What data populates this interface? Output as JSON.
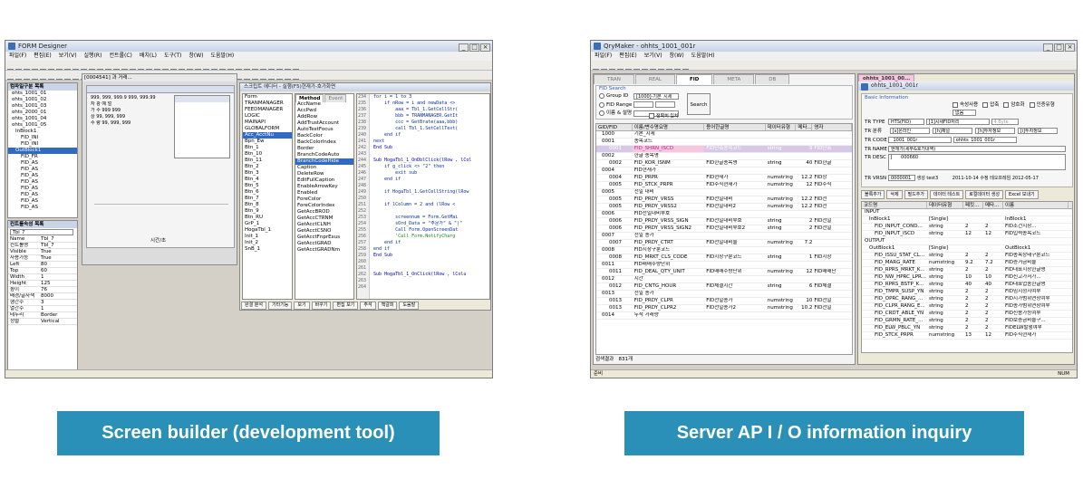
{
  "left": {
    "window_title": "FORM Designer",
    "menu": [
      "파일(F)",
      "편집(E)",
      "보기(V)",
      "실행(R)",
      "컨트롤(C)",
      "배치(L)",
      "도구(T)",
      "창(W)",
      "도움말(H)"
    ],
    "tree_panel_title": "컴파일구분 목록",
    "tree_items": [
      "ohts_1001_01",
      "ohts_1001_02",
      "ohts_1001_03",
      "ohts_2000_01",
      "ohts_1001_04",
      "ohts_1001_05",
      "InBlock1",
      "FID_INI",
      "FID_INI",
      "OutBlock1",
      "FID_FR",
      "FID_AS",
      "FID_AS",
      "FID_AS",
      "FID_AS",
      "FID_AS",
      "FID_AS",
      "FID_AS",
      "FID_AS"
    ],
    "props_panel_title": "컨트롤속성 목록",
    "props_combo": "Tbl_7",
    "props": [
      {
        "k": "Name",
        "v": "Tbl_7"
      },
      {
        "k": "컨트롤명",
        "v": "Tbl_7"
      },
      {
        "k": "Visible",
        "v": "True"
      },
      {
        "k": "사용가능",
        "v": "True"
      },
      {
        "k": "Left",
        "v": "80"
      },
      {
        "k": "Top",
        "v": "60"
      },
      {
        "k": "Width",
        "v": "1"
      },
      {
        "k": "Height",
        "v": "125"
      },
      {
        "k": "높이",
        "v": "76"
      },
      {
        "k": "배경/글자색",
        "v": "8000"
      },
      {
        "k": "행간수",
        "v": "3"
      },
      {
        "k": "열간수",
        "v": "1"
      },
      {
        "k": "테두리",
        "v": "Border"
      },
      {
        "k": "정렬",
        "v": "Vertical"
      }
    ],
    "status_time": "시간/초",
    "form_tab": "[0004541] 과 거래...",
    "grid_rows": [
      "999, 999, 999.9  999, 999.99",
      "자 광 예 얼",
      "가 수 999 999",
      "상   99, 999, 999",
      "수 량 99, 999, 999"
    ],
    "control_list_title": "스크립트 에디터",
    "controls": [
      "Form",
      "TRANMANAGER",
      "FEEDMANAGER",
      "LOGIC",
      "MAINAPI",
      "GLOBALFORM",
      "Acc_AcctNu",
      "Bpn_Ew",
      "Btn_1",
      "Btn_10",
      "Btn_11",
      "Btn_2",
      "Btn_3",
      "Btn_4",
      "Btn_5",
      "Btn_6",
      "Btn_7",
      "Btn_8",
      "Btn_9",
      "Btn_RU",
      "GrP_1",
      "HogaTbl_1",
      "Init_1",
      "Init_2",
      "SnB_1"
    ],
    "method_tab": "Method",
    "event_tab": "Event",
    "methods": [
      "AccName",
      "AccPwd",
      "AddRow",
      "AddTrustAccount",
      "AutoTextFocus",
      "BackColor",
      "BackColorIndex",
      "Border",
      "BranchCodeAuto",
      "BranchCodeHide",
      "Caption",
      "DeleteRow",
      "EditFullCaption",
      "EnableArrowKey",
      "Enabled",
      "ForeColor",
      "ForeColorIndex",
      "GetAccBROD",
      "GetAccCTRNM",
      "GetAcctCLNH",
      "GetAcctCSNO",
      "GetAcctFnprExus",
      "GetAcctGRAD",
      "GetAcctGRADNm"
    ],
    "script_title": "실행(F5)현재가-호가화면",
    "line_numbers": [
      "234",
      "235",
      "236",
      "237",
      "238",
      "239",
      "240",
      "241",
      "242",
      "243",
      "244",
      "245",
      "246",
      "247",
      "248",
      "249",
      "250",
      "251",
      "252",
      "253",
      "254",
      "255",
      "256",
      "257",
      "258",
      "259",
      "260",
      "261",
      "262",
      "263",
      "264"
    ],
    "code": [
      "for i = 1 to 3",
      "    if nRow = i and newData <> ",
      "        aaa = Tbl_1.GetCellStr(",
      "        bbb = TRANMANAGER.GetIt",
      "        ccc = GetBrate(aaa,bbb)",
      "        call Tbl_1.SetCellText(",
      "    end if",
      "next",
      "End Sub",
      "",
      "Sub HogaTbl_1_OnDblClick(lRow , lCol",
      "    if g_click <> \"2\" then",
      "        exit sub",
      "    end if",
      "",
      "    if HogaTbl_1.GetCellString(lRow",
      "",
      "    if lColumn = 2 and (lRow <",
      "",
      "        screennum = Form.GetMai",
      "        sOrd_Data = \"주문가\" & \"|\"",
      "        Call Form.OpenScreenDat",
      "        'Call Form.NotifyCharg",
      "    end if",
      "end if",
      "End Sub",
      "",
      "",
      "Sub HogaTbl_1_OnClick(lRow , lColu"
    ],
    "bottom_buttons": [
      "완결 분석",
      "기타기능",
      "보기",
      "바꾸기",
      "편집 보기",
      "주석",
      "책갈피",
      "도움말"
    ]
  },
  "right": {
    "window_title": "QryMaker - ohhts_1001_001r",
    "menu": [
      "파일(F)",
      "편집(E)",
      "보기(V)",
      "창(W)",
      "도움말(H)"
    ],
    "tabs": [
      "TRAN",
      "REAL",
      "FID",
      "META",
      "DB"
    ],
    "active_tab": "FID",
    "search_group": "FID Search",
    "group_id_label": "Group ID",
    "group_id_value": "[1000]-기본_시세",
    "fid_range_label": "FID Range",
    "name_label": "이름 & 설명",
    "search_button": "Search",
    "exact_label": "정확히 일치",
    "table_cols": [
      "GID/FID",
      "이름/변수명요명",
      "용어한글명",
      "데이터유형",
      "메타...",
      "영자"
    ],
    "table_rows": [
      {
        "id": "1000",
        "name": "기본_시세",
        "kor": "",
        "type": "",
        "len": "",
        "x": ""
      },
      {
        "id": "0001",
        "name": "종목코드",
        "kor": "",
        "type": "",
        "len": "",
        "x": ""
      },
      {
        "id": "0001",
        "name": "FID_SHRN_ISCD",
        "kor": "FID단축종목코드",
        "type": "string",
        "len": "9",
        "x": "FID단축"
      },
      {
        "id": "0002",
        "name": "한글 종목명",
        "kor": "",
        "type": "",
        "len": "",
        "x": ""
      },
      {
        "id": "0002",
        "name": "FID_KOR_ISNM",
        "kor": "FID한글종목명",
        "type": "string",
        "len": "40",
        "x": "FID한글"
      },
      {
        "id": "0004",
        "name": "FID현재가",
        "kor": "",
        "type": "",
        "len": "",
        "x": ""
      },
      {
        "id": "0004",
        "name": "FID_PRPR",
        "kor": "FID현재가",
        "type": "numstring",
        "len": "12.2",
        "x": "FID상"
      },
      {
        "id": "0005",
        "name": "FID_STCK_PRPR",
        "kor": "FID주식현재가",
        "type": "numstring",
        "len": "12",
        "x": "FID주식"
      },
      {
        "id": "0005",
        "name": "전일 대비",
        "kor": "",
        "type": "",
        "len": "",
        "x": ""
      },
      {
        "id": "0005",
        "name": "FID_PRDY_VRSS",
        "kor": "FID전일대비",
        "type": "numstring",
        "len": "12.2",
        "x": "FID전"
      },
      {
        "id": "0005",
        "name": "FID_PRDY_VRSS2",
        "kor": "FID전일대비2",
        "type": "numstring",
        "len": "12.2",
        "x": "FID전"
      },
      {
        "id": "0006",
        "name": "FID전일대비부호",
        "kor": "",
        "type": "",
        "len": "",
        "x": ""
      },
      {
        "id": "0006",
        "name": "FID_PRDY_VRSS_SIGN",
        "kor": "FID전일대비부호",
        "type": "string",
        "len": "2",
        "x": "FID전일"
      },
      {
        "id": "0006",
        "name": "FID_PRDY_VRSS_SIGN2",
        "kor": "FID전일대비부호2",
        "type": "string",
        "len": "2",
        "x": "FID전일"
      },
      {
        "id": "0007",
        "name": "전일 종가",
        "kor": "",
        "type": "",
        "len": "",
        "x": ""
      },
      {
        "id": "0007",
        "name": "FID_PRDY_CTRT",
        "kor": "FID전일대비율",
        "type": "numstring",
        "len": "7.2",
        "x": ""
      },
      {
        "id": "0008",
        "name": "FID시장구분코드",
        "kor": "",
        "type": "",
        "len": "",
        "x": ""
      },
      {
        "id": "0008",
        "name": "FID_MRKT_CLS_CODE",
        "kor": "FID시장구분코드",
        "type": "string",
        "len": "1",
        "x": "FID시장"
      },
      {
        "id": "0011",
        "name": "FID매매수량단위",
        "kor": "",
        "type": "",
        "len": "",
        "x": ""
      },
      {
        "id": "0011",
        "name": "FID_DEAL_QTY_UNIT",
        "kor": "FID매매수량단위",
        "type": "numstring",
        "len": "12",
        "x": "FID매매단"
      },
      {
        "id": "0012",
        "name": "시간",
        "kor": "",
        "type": "",
        "len": "",
        "x": ""
      },
      {
        "id": "0012",
        "name": "FID_CNTG_HOUR",
        "kor": "FID체결시간",
        "type": "string",
        "len": "6",
        "x": "FID체결"
      },
      {
        "id": "0013",
        "name": "전일 종가",
        "kor": "",
        "type": "",
        "len": "",
        "x": ""
      },
      {
        "id": "0013",
        "name": "FID_PRDY_CLPR",
        "kor": "FID전일종가",
        "type": "numstring",
        "len": "10",
        "x": "FID전일"
      },
      {
        "id": "0013",
        "name": "FID_PRDY_CLPR2",
        "kor": "FID전일종가2",
        "type": "numstring",
        "len": "10.2",
        "x": "FID전일"
      },
      {
        "id": "0014",
        "name": "누적 거래량",
        "kor": "",
        "type": "",
        "len": "",
        "x": ""
      }
    ],
    "result_label": "검색결과",
    "result_count": "831개",
    "status_left": "준비",
    "status_right": "NUM",
    "inner_tab": "ohhts_1001_00...",
    "inner_title": "ohhts_1001_001r",
    "basic_info": "Basic Information",
    "checks": [
      "속성사용",
      "압축",
      "암호화",
      "인증유형"
    ],
    "auth_value": "없음",
    "tr_type_label": "TR TYPE",
    "tr_type_value": "HTS(FID)",
    "tr_type_value2": "[1]시세FID처리",
    "tr_type_value3": "4 Byte",
    "tr_class_label": "TR 분류",
    "tr_class_values": [
      "[s]온라인",
      "[h]채널",
      "[h]투자정보",
      "[i]투자정보"
    ],
    "tr_code_label": "TR CODE",
    "tr_code_value": "_1001_001r",
    "tr_code_value2": "ohhts_1001_001r",
    "tr_name_label": "TR NAME",
    "tr_name_value": "현재가(세부&호가내역)",
    "tr_desc_label": "TR DESC",
    "tr_desc_value": "J",
    "tr_desc_value2": "000660",
    "tr_vrsn_label": "TR VRSN",
    "tr_vrsn_value": "0000001",
    "created_label": "생성",
    "created_by": "test3",
    "created_date": "2011-10-14",
    "modified_label": "수정",
    "modified_by": "테오프레임",
    "modified_date": "2012-05-17",
    "action_buttons": [
      "블록추가",
      "삭제",
      "필드추가",
      "데이터 테스트",
      "로컬데이터 생성",
      "Excel 보내기"
    ],
    "io_cols": [
      "코드명",
      "데이터유형",
      "페킷...",
      "메타...",
      "이름"
    ],
    "io_rows": [
      {
        "name": "INPUT",
        "type": "",
        "p": "",
        "m": "",
        "n": ""
      },
      {
        "name": "InBlock1",
        "type": "[Single]",
        "p": "",
        "m": "",
        "n": "InBlock1"
      },
      {
        "name": "FID_INPUT_COND...",
        "type": "string",
        "p": "2",
        "m": "2",
        "n": "FID조건시장..."
      },
      {
        "name": "FID_INPUT_ISCD",
        "type": "string",
        "p": "12",
        "m": "12",
        "n": "FID입력종목코드"
      },
      {
        "name": "OUTPUT",
        "type": "",
        "p": "",
        "m": "",
        "n": ""
      },
      {
        "name": "OutBlock1",
        "type": "[Single]",
        "p": "",
        "m": "",
        "n": "OutBlock1"
      },
      {
        "name": "FID_ISSU_STAT_CL...",
        "type": "string",
        "p": "2",
        "m": "2",
        "n": "FID종목상태구분코드"
      },
      {
        "name": "FID_MARG_RATE",
        "type": "numstring",
        "p": "9.2",
        "m": "7.2",
        "n": "FID증거금비율"
      },
      {
        "name": "FID_RPRS_MRKT_K...",
        "type": "string",
        "p": "2",
        "m": "2",
        "n": "FID대표시장한글명"
      },
      {
        "name": "FID_NW_HPRC_LPR...",
        "type": "string",
        "p": "10",
        "m": "10",
        "n": "FID신고가저가..."
      },
      {
        "name": "FID_RPRS_BSTP_K...",
        "type": "string",
        "p": "40",
        "m": "40",
        "n": "FID대표업종한글명"
      },
      {
        "name": "FID_TMPR_SUSP_YN",
        "type": "string",
        "p": "2",
        "m": "2",
        "n": "FID임시정지여부"
      },
      {
        "name": "FID_OPRC_RANG_...",
        "type": "string",
        "p": "2",
        "m": "2",
        "n": "FID시가범위연장여부"
      },
      {
        "name": "FID_CLPR_RANG_E...",
        "type": "string",
        "p": "2",
        "m": "2",
        "n": "FID종가범위연장여부"
      },
      {
        "name": "FID_CRDT_ABLE_YN",
        "type": "string",
        "p": "2",
        "m": "2",
        "n": "FID신용가능여부"
      },
      {
        "name": "FID_GRMN_RATE_...",
        "type": "string",
        "p": "2",
        "m": "2",
        "n": "FID보증금비율구..."
      },
      {
        "name": "FID_ELW_PBLC_YN",
        "type": "string",
        "p": "2",
        "m": "2",
        "n": "FIDELW발행여부"
      },
      {
        "name": "FID_STCK_PRPR",
        "type": "numstring",
        "p": "13",
        "m": "12",
        "n": "FID주식현재가"
      }
    ],
    "status_num": "NUM"
  },
  "captions": {
    "left": "Screen builder (development tool)",
    "right": "Server AP I / O information inquiry"
  },
  "colors": {
    "caption_bg": "#2a90b8",
    "caption_text": "#ffffff",
    "selection": "#316ac5",
    "highlight_pink": "#f7c7e0"
  }
}
